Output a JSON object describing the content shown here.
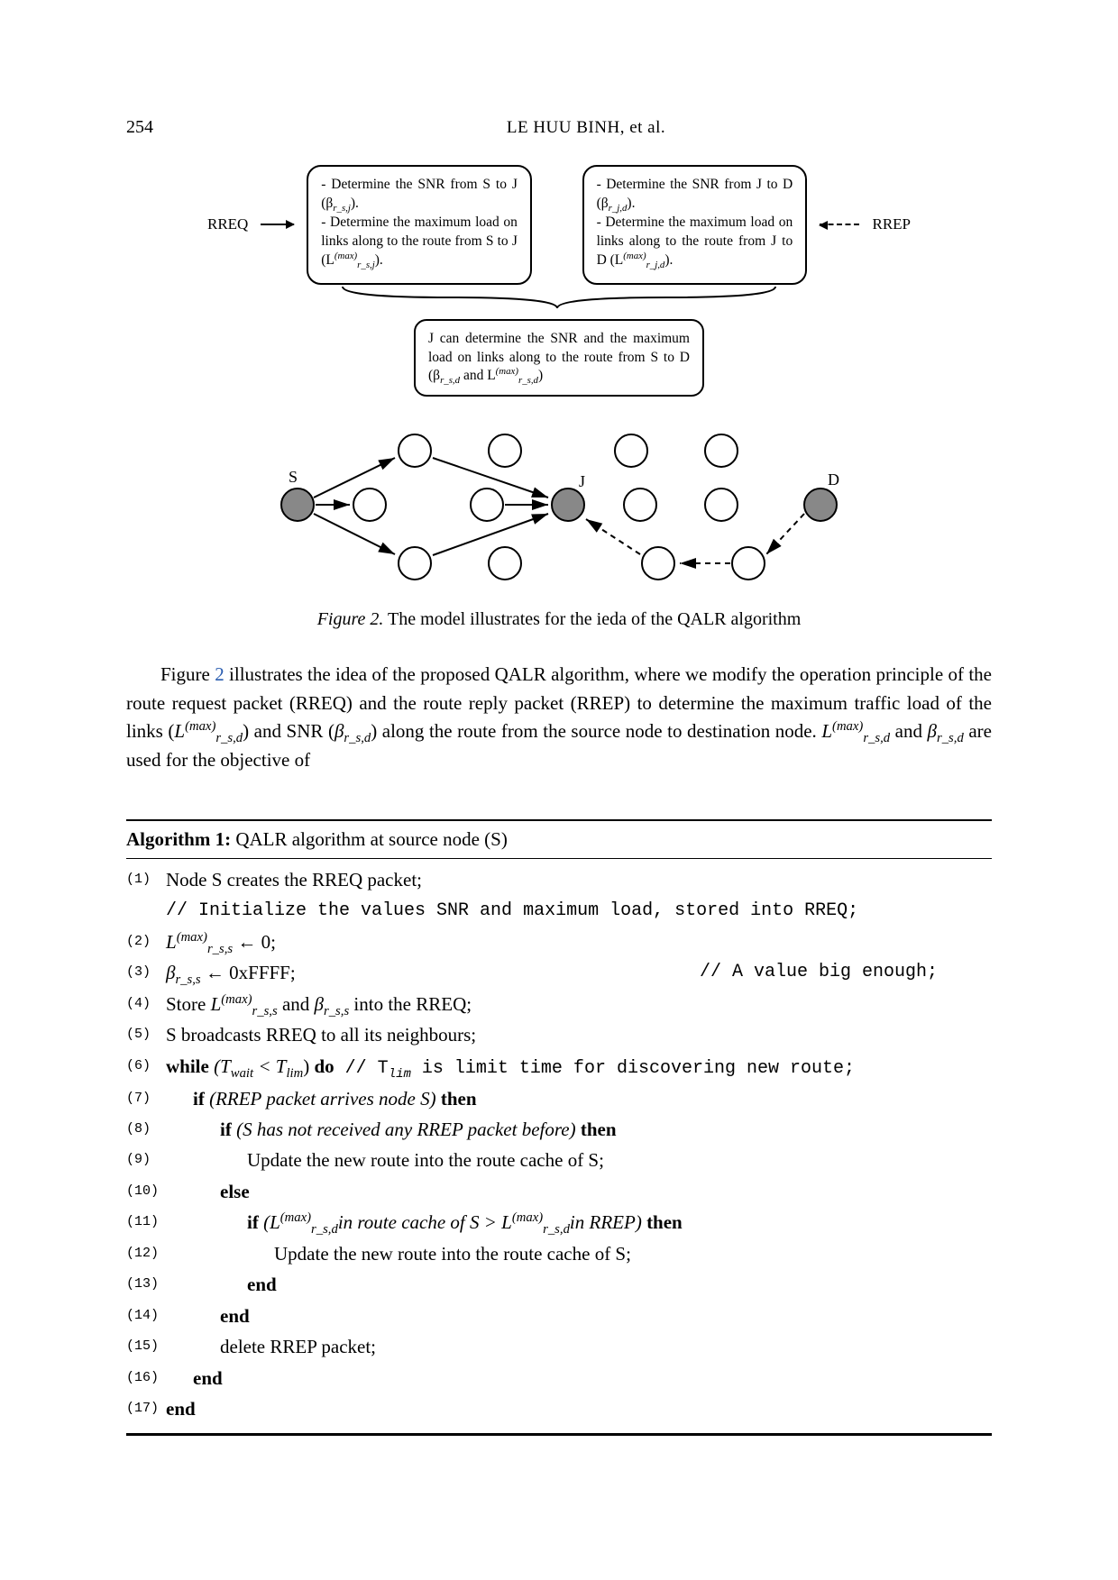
{
  "page_number": "254",
  "running_title": "LE HUU BINH, et al.",
  "figure": {
    "rreq_label": "RREQ",
    "rrep_label": "RREP",
    "box_left_l1": "- Determine the SNR from S to J (β",
    "box_left_l1_sub": "r_s,j",
    "box_left_l1_end": ").",
    "box_left_l2": "- Determine the maximum load on links along to the route from S to J (L",
    "box_left_l2_sup": "(max)",
    "box_left_l2_sub": "r_s,j",
    "box_left_l2_end": ").",
    "box_right_l1": "- Determine the SNR from J to D (β",
    "box_right_l1_sub": "r_j,d",
    "box_right_l1_end": ").",
    "box_right_l2": "- Determine the maximum load on links along to the route from J to D (L",
    "box_right_l2_sup": "(max)",
    "box_right_l2_sub": "r_j,d",
    "box_right_l2_end": ").",
    "mid_box": "J can determine the SNR and the maximum load on links along to the route from S to D (β",
    "mid_box_sub1": "r_s,d",
    "mid_box_mid": " and L",
    "mid_box_sup2": "(max)",
    "mid_box_sub2": "r_s,d",
    "mid_box_end": ")",
    "node_S": "S",
    "node_J": "J",
    "node_D": "D",
    "caption_prefix": "Figure 2.",
    "caption_text": " The model illustrates for the ieda of the QALR algorithm"
  },
  "paragraph": {
    "p1_a": "Figure ",
    "p1_ref": "2",
    "p1_b": " illustrates the idea of the proposed QALR algorithm, where we modify the operation principle of the route request packet (RREQ) and the route reply packet (RREP) to determine the maximum traffic load of the links (",
    "sym_L": "L",
    "sup_max": "(max)",
    "sub_rsd": "r_s,d",
    "p1_c": ") and SNR (",
    "sym_beta": "β",
    "p1_d": ") along the route from the source node to destination node. ",
    "p1_e": " and ",
    "p1_f": " are used for the objective of"
  },
  "algorithm": {
    "title_prefix": "Algorithm 1:",
    "title_text": " QALR algorithm at source node (S)",
    "lines": {
      "1": "Node S creates the RREQ packet;",
      "c1": "// Initialize the values SNR and maximum load, stored into RREQ;",
      "2a": "L",
      "2b": " ← 0;",
      "sub_rss": "r_s,s",
      "3a": "β",
      "3b": " ← 0xFFFF;",
      "3c": "// A value big enough;",
      "4a": "Store ",
      "4b": " and ",
      "4c": " into the RREQ;",
      "5": "S broadcasts RREQ to all its neighbours;",
      "6a": "while",
      "6b": " (T",
      "6b_sub_wait": "wait",
      "6c": " < T",
      "6c_sub_lim": "lim",
      "6d": ") ",
      "6e": "do",
      "6f": " // T",
      "6g": " is limit time for discovering new route;",
      "7a": "if",
      "7b": " (RREP packet arrives node S) ",
      "7c": "then",
      "8a": "if",
      "8b": " (S has not received any RREP packet before) ",
      "8c": "then",
      "9": "Update the new route into the route cache of S;",
      "10": "else",
      "11a": "if",
      "11b1": " (L",
      "11b2": "in route cache of S > L",
      "11c": "in RREP) ",
      "11d": "then",
      "12": "Update the new route into the route cache of S;",
      "13": "end",
      "14": "end",
      "15": "delete RREP packet;",
      "16": "end",
      "17": "end"
    }
  }
}
